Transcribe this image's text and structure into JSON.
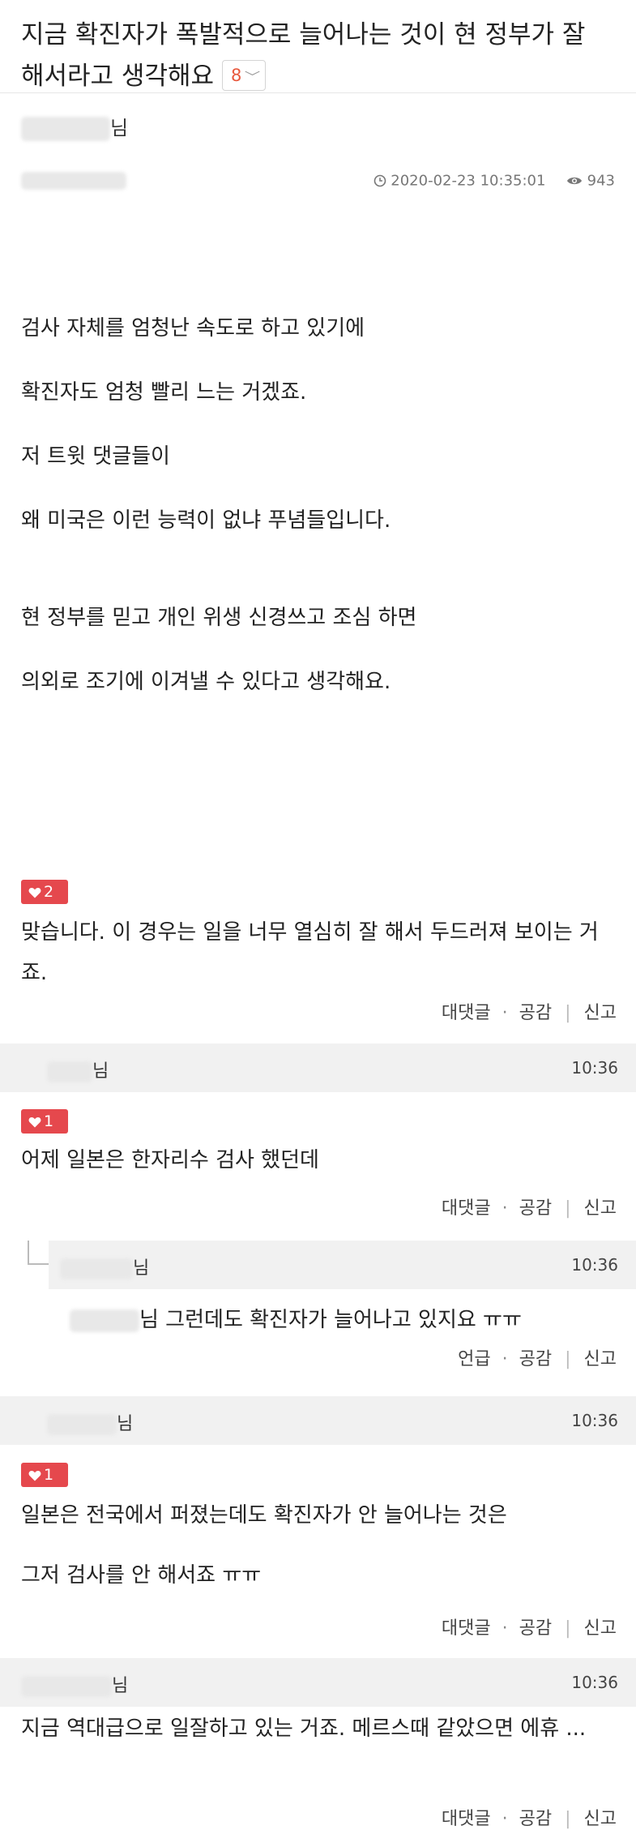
{
  "post": {
    "title": "지금 확진자가 폭발적으로 늘어나는 것이 현 정부가 잘 해서라고 생각해요",
    "comment_count": "8",
    "author_suffix": "님",
    "datetime": "2020-02-23 10:35:01",
    "views": "943",
    "body_lines": [
      "검사 자체를 엄청난 속도로 하고 있기에",
      "확진자도 엄청 빨리 느는 거겠죠.",
      "저 트윗 댓글들이",
      "왜 미국은 이런 능력이 없냐 푸념들입니다.",
      "현 정부를 믿고 개인 위생 신경쓰고 조심 하면",
      "의외로 조기에 이겨낼 수 있다고 생각해요."
    ]
  },
  "labels": {
    "reply": "대댓글",
    "like": "공감",
    "report": "신고",
    "mention": "언급",
    "dot": "·",
    "bar": "|",
    "nim": "님"
  },
  "comments": [
    {
      "likes": "2",
      "text": "맞습니다. 이 경우는 일을 너무 열심히 잘 해서 두드러져 보이는 거죠.",
      "time": "10:36"
    },
    {
      "likes": "1",
      "text": "어제 일본은 한자리수 검사 했던데",
      "time": "10:36",
      "reply": {
        "time": "10:36",
        "text": "님 그런데도 확진자가 늘어나고 있지요 ㅠㅠ"
      }
    },
    {
      "likes": "1",
      "text_lines": [
        "일본은 전국에서 퍼졌는데도 확진자가 안 늘어나는 것은",
        "그저 검사를 안 해서죠 ㅠㅠ"
      ],
      "time": "10:36"
    },
    {
      "text": "지금 역대급으로 일잘하고 있는 거죠. 메르스때 같았으면 에휴 ..."
    }
  ],
  "colors": {
    "heart_badge": "#e5484d",
    "count_accent": "#e8583d",
    "header_bg": "#f1f1f1"
  }
}
